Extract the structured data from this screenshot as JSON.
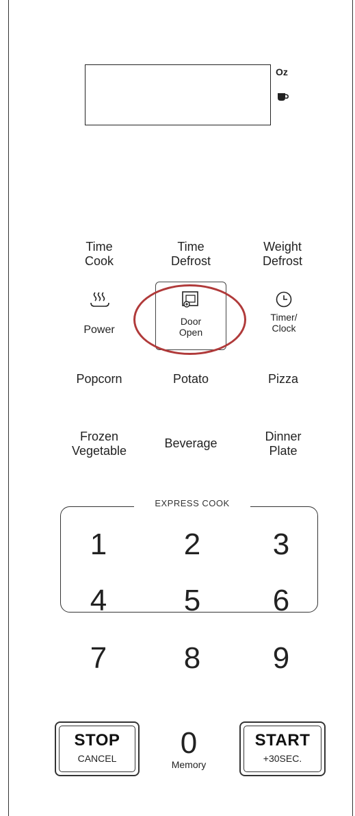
{
  "display": {
    "oz_label": "Oz",
    "cup_icon": "cup-icon"
  },
  "keys": {
    "time_cook": "Time\nCook",
    "time_defrost": "Time\nDefrost",
    "weight_defrost": "Weight\nDefrost",
    "power": "Power",
    "door_open": "Door\nOpen",
    "timer_clock": "Timer/\nClock",
    "popcorn": "Popcorn",
    "potato": "Potato",
    "pizza": "Pizza",
    "frozen_vegetable": "Frozen\nVegetable",
    "beverage": "Beverage",
    "dinner_plate": "Dinner\nPlate"
  },
  "express_cook": {
    "label": "EXPRESS COOK",
    "digits": [
      "1",
      "2",
      "3",
      "4",
      "5",
      "6"
    ]
  },
  "digits_lower": [
    "7",
    "8",
    "9"
  ],
  "zero": {
    "digit": "0",
    "label": "Memory"
  },
  "stop": {
    "main": "STOP",
    "sub": "CANCEL"
  },
  "start": {
    "main": "START",
    "sub": "+30SEC."
  },
  "colors": {
    "highlight": "#b03a3a",
    "line": "#333333"
  }
}
